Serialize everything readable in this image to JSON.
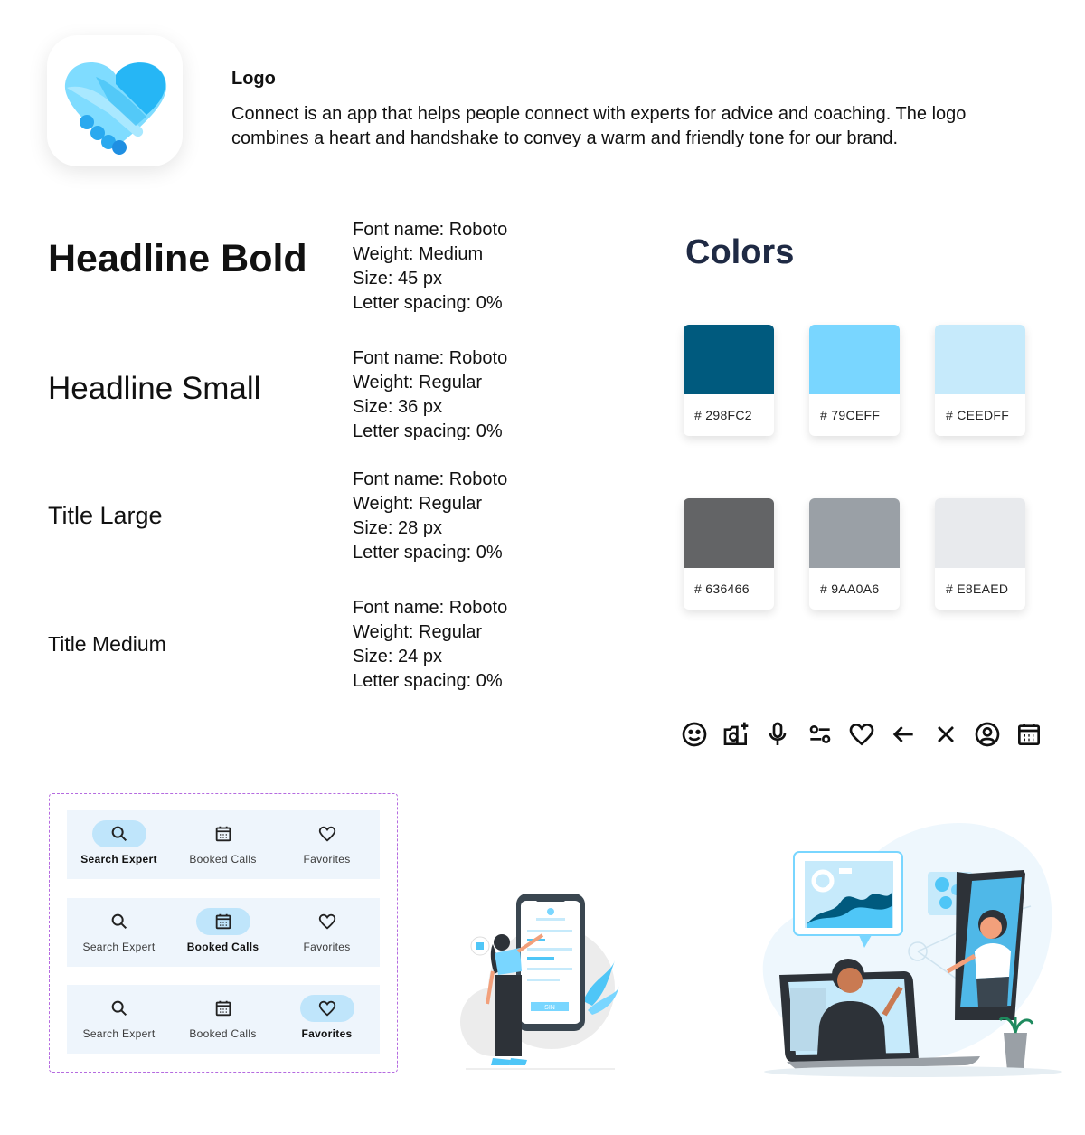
{
  "logo": {
    "title": "Logo",
    "description": "Connect is an app that helps people connect with experts for advice and coaching. The logo combines a heart and handshake to convey a warm and friendly tone for our brand."
  },
  "typography": [
    {
      "sample": "Headline Bold",
      "font": "Font name: Roboto",
      "weight": "Weight: Medium",
      "size": "Size: 45 px",
      "spacing": "Letter spacing: 0%"
    },
    {
      "sample": "Headline Small",
      "font": "Font name: Roboto",
      "weight": "Weight: Regular",
      "size": "Size: 36 px",
      "spacing": "Letter spacing: 0%"
    },
    {
      "sample": "Title Large",
      "font": "Font name: Roboto",
      "weight": "Weight: Regular",
      "size": "Size: 28 px",
      "spacing": "Letter spacing: 0%"
    },
    {
      "sample": "Title Medium",
      "font": "Font name: Roboto",
      "weight": "Weight: Regular",
      "size": "Size: 24 px",
      "spacing": "Letter spacing: 0%"
    }
  ],
  "colors": {
    "title": "Colors",
    "swatches": [
      {
        "hex": "# 298FC2",
        "value": "#005a7e"
      },
      {
        "hex": "# 79CEFF",
        "value": "#79d6ff"
      },
      {
        "hex": "# CEEDFF",
        "value": "#c6eafb"
      },
      {
        "hex": "# 636466",
        "value": "#636466"
      },
      {
        "hex": "# 9AA0A6",
        "value": "#9aa0a6"
      },
      {
        "hex": "# E8EAED",
        "value": "#e8eaed"
      }
    ]
  },
  "icons": [
    "smile-icon",
    "add-photo-icon",
    "microphone-icon",
    "tune-icon",
    "heart-icon",
    "arrow-left-icon",
    "close-icon",
    "account-circle-icon",
    "calendar-icon"
  ],
  "navbars": [
    {
      "active": 0,
      "items": [
        "Search Expert",
        "Booked Calls",
        "Favorites"
      ]
    },
    {
      "active": 1,
      "items": [
        "Search Expert",
        "Booked Calls",
        "Favorites"
      ]
    },
    {
      "active": 2,
      "items": [
        "Search Expert",
        "Booked Calls",
        "Favorites"
      ]
    }
  ],
  "illustrations": {
    "phone_button": "SIN"
  }
}
